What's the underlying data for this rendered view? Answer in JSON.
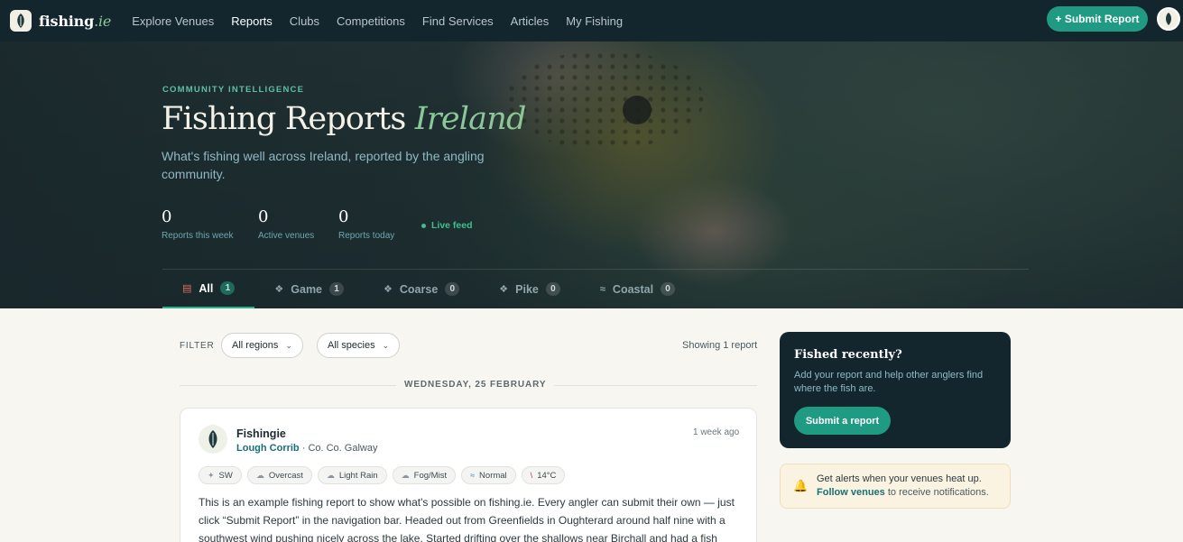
{
  "nav": {
    "logo_name": "fishing",
    "logo_tld": ".ie",
    "links": [
      "Explore Venues",
      "Reports",
      "Clubs",
      "Competitions",
      "Find Services",
      "Articles",
      "My Fishing"
    ],
    "active_link": "Reports",
    "submit_label": "+ Submit Report",
    "accent_color": "#1f9a83"
  },
  "hero": {
    "eyebrow": "COMMUNITY INTELLIGENCE",
    "title_main": "Fishing Reports",
    "title_accent": "Ireland",
    "subtitle": "What's fishing well across Ireland, reported by the angling community.",
    "stats": [
      {
        "value": "0",
        "label": "Reports this week"
      },
      {
        "value": "0",
        "label": "Active venues"
      },
      {
        "value": "0",
        "label": "Reports today"
      }
    ],
    "live_label": "Live feed"
  },
  "tabs": [
    {
      "icon": "report-icon",
      "label": "All",
      "count": "1",
      "active": true
    },
    {
      "icon": "fish-hook-icon",
      "label": "Game",
      "count": "1",
      "active": false
    },
    {
      "icon": "fish-hook-icon",
      "label": "Coarse",
      "count": "0",
      "active": false
    },
    {
      "icon": "fish-hook-icon",
      "label": "Pike",
      "count": "0",
      "active": false
    },
    {
      "icon": "wave-icon",
      "label": "Coastal",
      "count": "0",
      "active": false
    }
  ],
  "filter": {
    "label": "FILTER",
    "region_value": "All regions",
    "species_value": "All species",
    "showing": "Showing 1 report"
  },
  "date_separator": "WEDNESDAY, 25 FEBRUARY",
  "report": {
    "author": "Fishingie",
    "venue": "Lough Corrib",
    "location": "· Co. Co. Galway",
    "time_ago": "1 week ago",
    "conditions": [
      {
        "icon": "wind-icon",
        "label": "SW"
      },
      {
        "icon": "cloud-icon",
        "label": "Overcast"
      },
      {
        "icon": "rain-icon",
        "label": "Light Rain"
      },
      {
        "icon": "fog-icon",
        "label": "Fog/Mist"
      },
      {
        "icon": "water-level-icon",
        "label": "Normal"
      },
      {
        "icon": "thermometer-icon",
        "label": "14°C"
      }
    ],
    "body": "This is an example fishing report to show what's possible on fishing.ie. Every angler can submit their own — just click “Submit Report” in the navigation bar. Headed out from Greenfields in Oughterard around half nine with a southwest wind pushing nicely across the lake. Started drifting over the shallows near Birchall and had a fish com..."
  },
  "sidebar": {
    "promo_title": "Fished recently?",
    "promo_text": "Add your report and help other anglers find where the fish are.",
    "promo_button": "Submit a report",
    "alert_title": "Get alerts when your venues heat up.",
    "alert_link": "Follow venues",
    "alert_text": "to receive notifications."
  }
}
